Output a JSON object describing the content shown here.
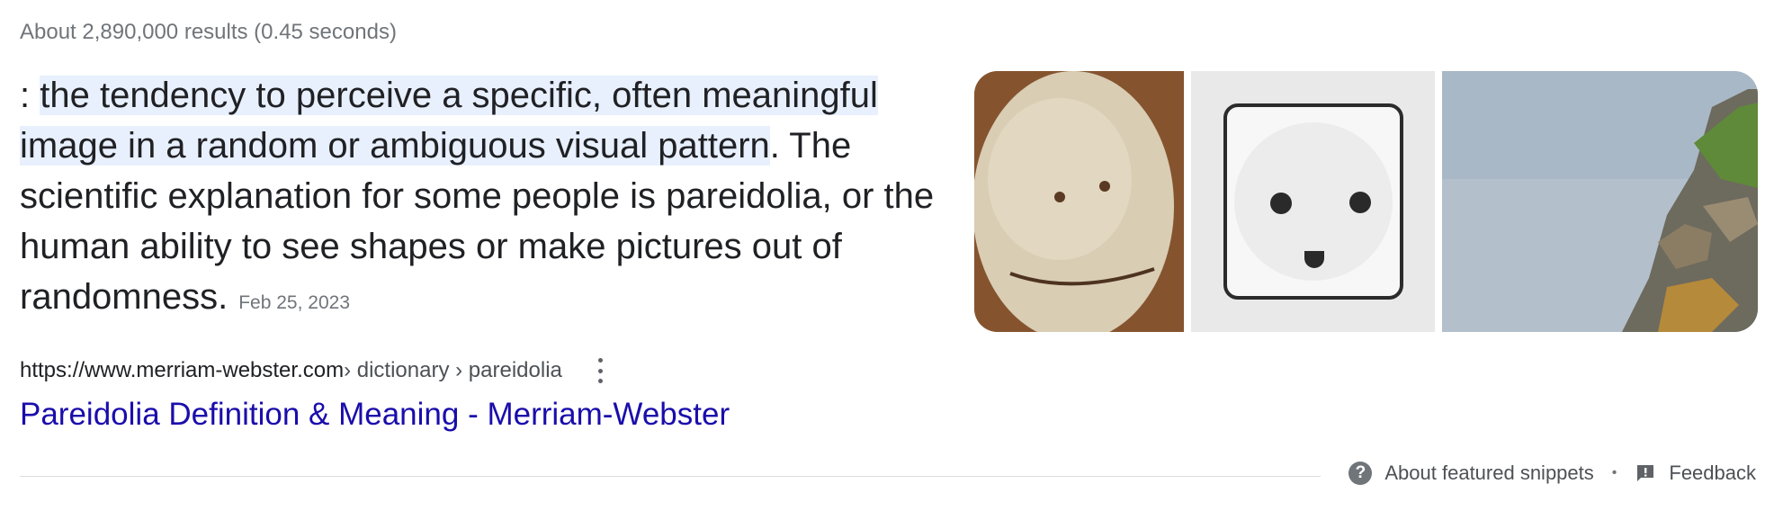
{
  "result_stats": "About 2,890,000 results (0.45 seconds)",
  "snippet": {
    "prefix": ": ",
    "highlighted": "the tendency to perceive a specific, often meaningful image in a random or ambiguous visual pattern",
    "rest": ". The scientific explanation for some people is pareidolia, or the human ability to see shapes or make pictures out of randomness.",
    "date": "Feb 25, 2023"
  },
  "images": [
    {
      "icon": "potato-face-image"
    },
    {
      "icon": "outlet-face-image"
    },
    {
      "icon": "rock-face-image"
    }
  ],
  "source": {
    "url": "https://www.merriam-webster.com",
    "breadcrumb": " › dictionary › pareidolia"
  },
  "result_title": "Pareidolia Definition & Meaning - Merriam-Webster",
  "footer": {
    "about_label": "About featured snippets",
    "separator": "•",
    "feedback_label": "Feedback"
  },
  "colors": {
    "link": "#1a0dab",
    "highlight": "#e8f0fe",
    "muted": "#70757a"
  }
}
